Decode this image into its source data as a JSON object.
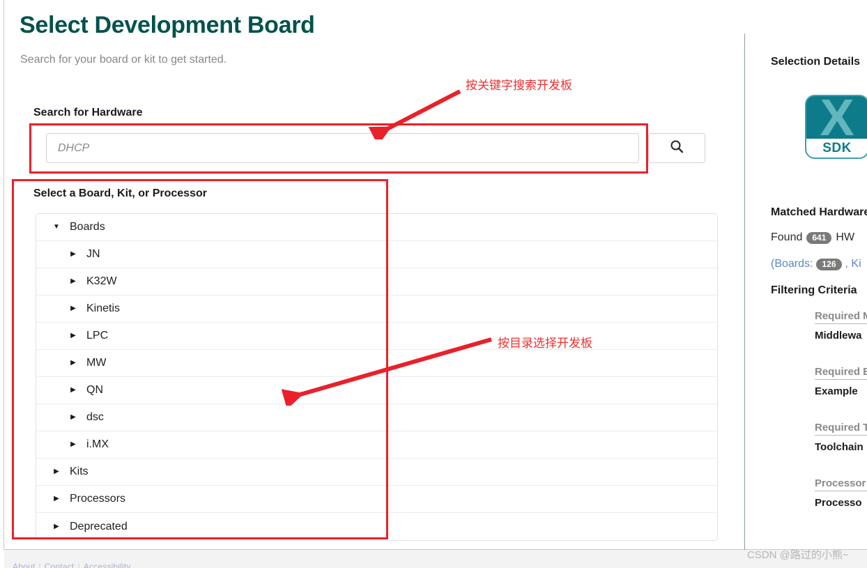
{
  "header": {
    "title": "Select Development Board",
    "subtitle": "Search for your board or kit to get started."
  },
  "search": {
    "label": "Search for Hardware",
    "value": "",
    "placeholder": "DHCP",
    "button_icon": "search-icon"
  },
  "tree": {
    "label": "Select a Board, Kit, or Processor",
    "expanded_glyph": "▼",
    "collapsed_glyph": "▶",
    "rows": [
      {
        "label": "Boards",
        "level": 0,
        "expanded": true
      },
      {
        "label": "JN",
        "level": 1,
        "expanded": false
      },
      {
        "label": "K32W",
        "level": 1,
        "expanded": false
      },
      {
        "label": "Kinetis",
        "level": 1,
        "expanded": false
      },
      {
        "label": "LPC",
        "level": 1,
        "expanded": false
      },
      {
        "label": "MW",
        "level": 1,
        "expanded": false
      },
      {
        "label": "QN",
        "level": 1,
        "expanded": false
      },
      {
        "label": "dsc",
        "level": 1,
        "expanded": false
      },
      {
        "label": "i.MX",
        "level": 1,
        "expanded": false
      },
      {
        "label": "Kits",
        "level": 0,
        "expanded": false
      },
      {
        "label": "Processors",
        "level": 0,
        "expanded": false
      },
      {
        "label": "Deprecated",
        "level": 0,
        "expanded": false
      }
    ]
  },
  "panel": {
    "title": "Selection Details",
    "logo": {
      "glyph": "X",
      "caption": "SDK"
    },
    "matched_title": "Matched Hardware",
    "found_prefix": "Found",
    "found_count": "641",
    "found_suffix": "HW",
    "breakdown_open": "(Boards:",
    "boards_count": "126",
    "breakdown_tail": ", Ki",
    "filter_title": "Filtering Criteria",
    "criteria": [
      {
        "head": "Required M",
        "value": "Middlewa"
      },
      {
        "head": "Required Ex",
        "value": "Example"
      },
      {
        "head": "Required To",
        "value": "Toolchain"
      },
      {
        "head": "Processor F",
        "value": "Processo"
      }
    ]
  },
  "annotations": {
    "search_note": "按关键字搜索开发板",
    "tree_note": "按目录选择开发板",
    "color": "#e8212a"
  },
  "footer": {
    "links": [
      "About",
      "Contact",
      "Accessibility"
    ],
    "separator": "|"
  },
  "watermark": "CSDN @路过的小熊~"
}
